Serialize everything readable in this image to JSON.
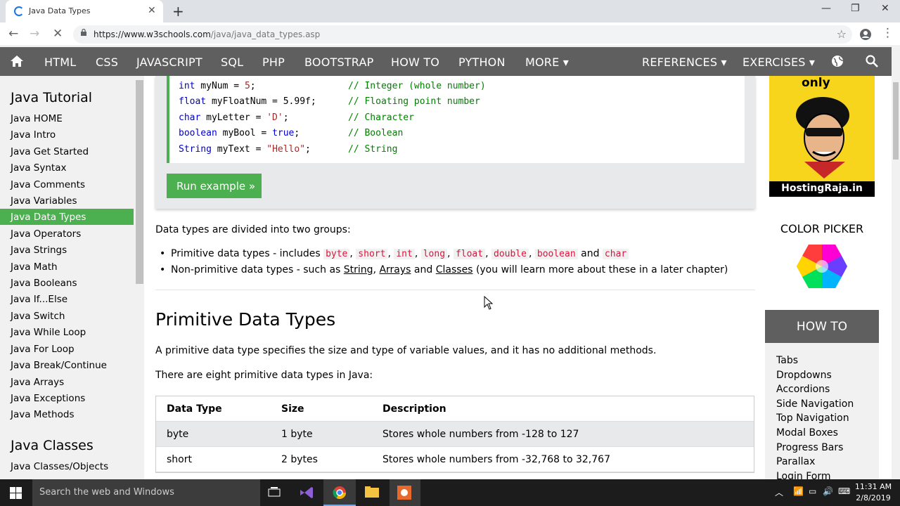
{
  "browser": {
    "tab_title": "Java Data Types",
    "new_tab": "+",
    "url_host": "https://www.w3schools.com",
    "url_path": "/java/java_data_types.asp"
  },
  "navbar": {
    "items": [
      "HTML",
      "CSS",
      "JAVASCRIPT",
      "SQL",
      "PHP",
      "BOOTSTRAP",
      "HOW TO",
      "PYTHON",
      "MORE ▾"
    ],
    "right_items": [
      "REFERENCES ▾",
      "EXERCISES ▾"
    ]
  },
  "sidebar": {
    "heading1": "Java Tutorial",
    "items": [
      "Java HOME",
      "Java Intro",
      "Java Get Started",
      "Java Syntax",
      "Java Comments",
      "Java Variables",
      "Java Data Types",
      "Java Operators",
      "Java Strings",
      "Java Math",
      "Java Booleans",
      "Java If...Else",
      "Java Switch",
      "Java While Loop",
      "Java For Loop",
      "Java Break/Continue",
      "Java Arrays",
      "Java Exceptions",
      "Java Methods"
    ],
    "active_index": 6,
    "heading2": "Java Classes",
    "items2": [
      "Java Classes/Objects"
    ]
  },
  "code": {
    "lines": [
      {
        "type": "int",
        "rest": " myNum = ",
        "val": "5",
        "end": ";",
        "comment": "// Integer (whole number)"
      },
      {
        "type": "float",
        "rest": " myFloatNum = 5.99f;",
        "val": "",
        "end": "",
        "comment": "// Floating point number"
      },
      {
        "type": "char",
        "rest": " myLetter = ",
        "val": "'D'",
        "end": ";",
        "comment": "// Character"
      },
      {
        "type": "boolean",
        "rest": " myBool = ",
        "val": "true",
        "end": ";",
        "comment": "// Boolean"
      },
      {
        "type": "String",
        "rest": " myText = ",
        "val": "\"Hello\"",
        "end": ";",
        "comment": "// String"
      }
    ],
    "run_button": "Run example »"
  },
  "content": {
    "intro": "Data types are divided into two groups:",
    "bullet1_prefix": "Primitive data types - includes",
    "bullet1_types": [
      "byte",
      "short",
      "int",
      "long",
      "float",
      "double",
      "boolean"
    ],
    "bullet1_and": "and",
    "bullet1_last": "char",
    "bullet2_prefix": "Non-primitive data types - such as",
    "bullet2_links": [
      "String",
      "Arrays",
      "Classes"
    ],
    "bullet2_suffix": "(you will learn more about these in a later chapter)",
    "heading": "Primitive Data Types",
    "para1": "A primitive data type specifies the size and type of variable values, and it has no additional methods.",
    "para2": "There are eight primitive data types in Java:"
  },
  "table": {
    "headers": [
      "Data Type",
      "Size",
      "Description"
    ],
    "rows": [
      [
        "byte",
        "1 byte",
        "Stores whole numbers from -128 to 127"
      ],
      [
        "short",
        "2 bytes",
        "Stores whole numbers from -32,768 to 32,767"
      ]
    ]
  },
  "right": {
    "ad_top": "only",
    "ad_brand": "HostingRaja.in",
    "color_picker": "COLOR PICKER",
    "howto_title": "HOW TO",
    "howto_items": [
      "Tabs",
      "Dropdowns",
      "Accordions",
      "Side Navigation",
      "Top Navigation",
      "Modal Boxes",
      "Progress Bars",
      "Parallax",
      "Login Form"
    ]
  },
  "taskbar": {
    "search": "Search the web and Windows",
    "time": "11:31 AM",
    "date": "2/8/2019"
  }
}
